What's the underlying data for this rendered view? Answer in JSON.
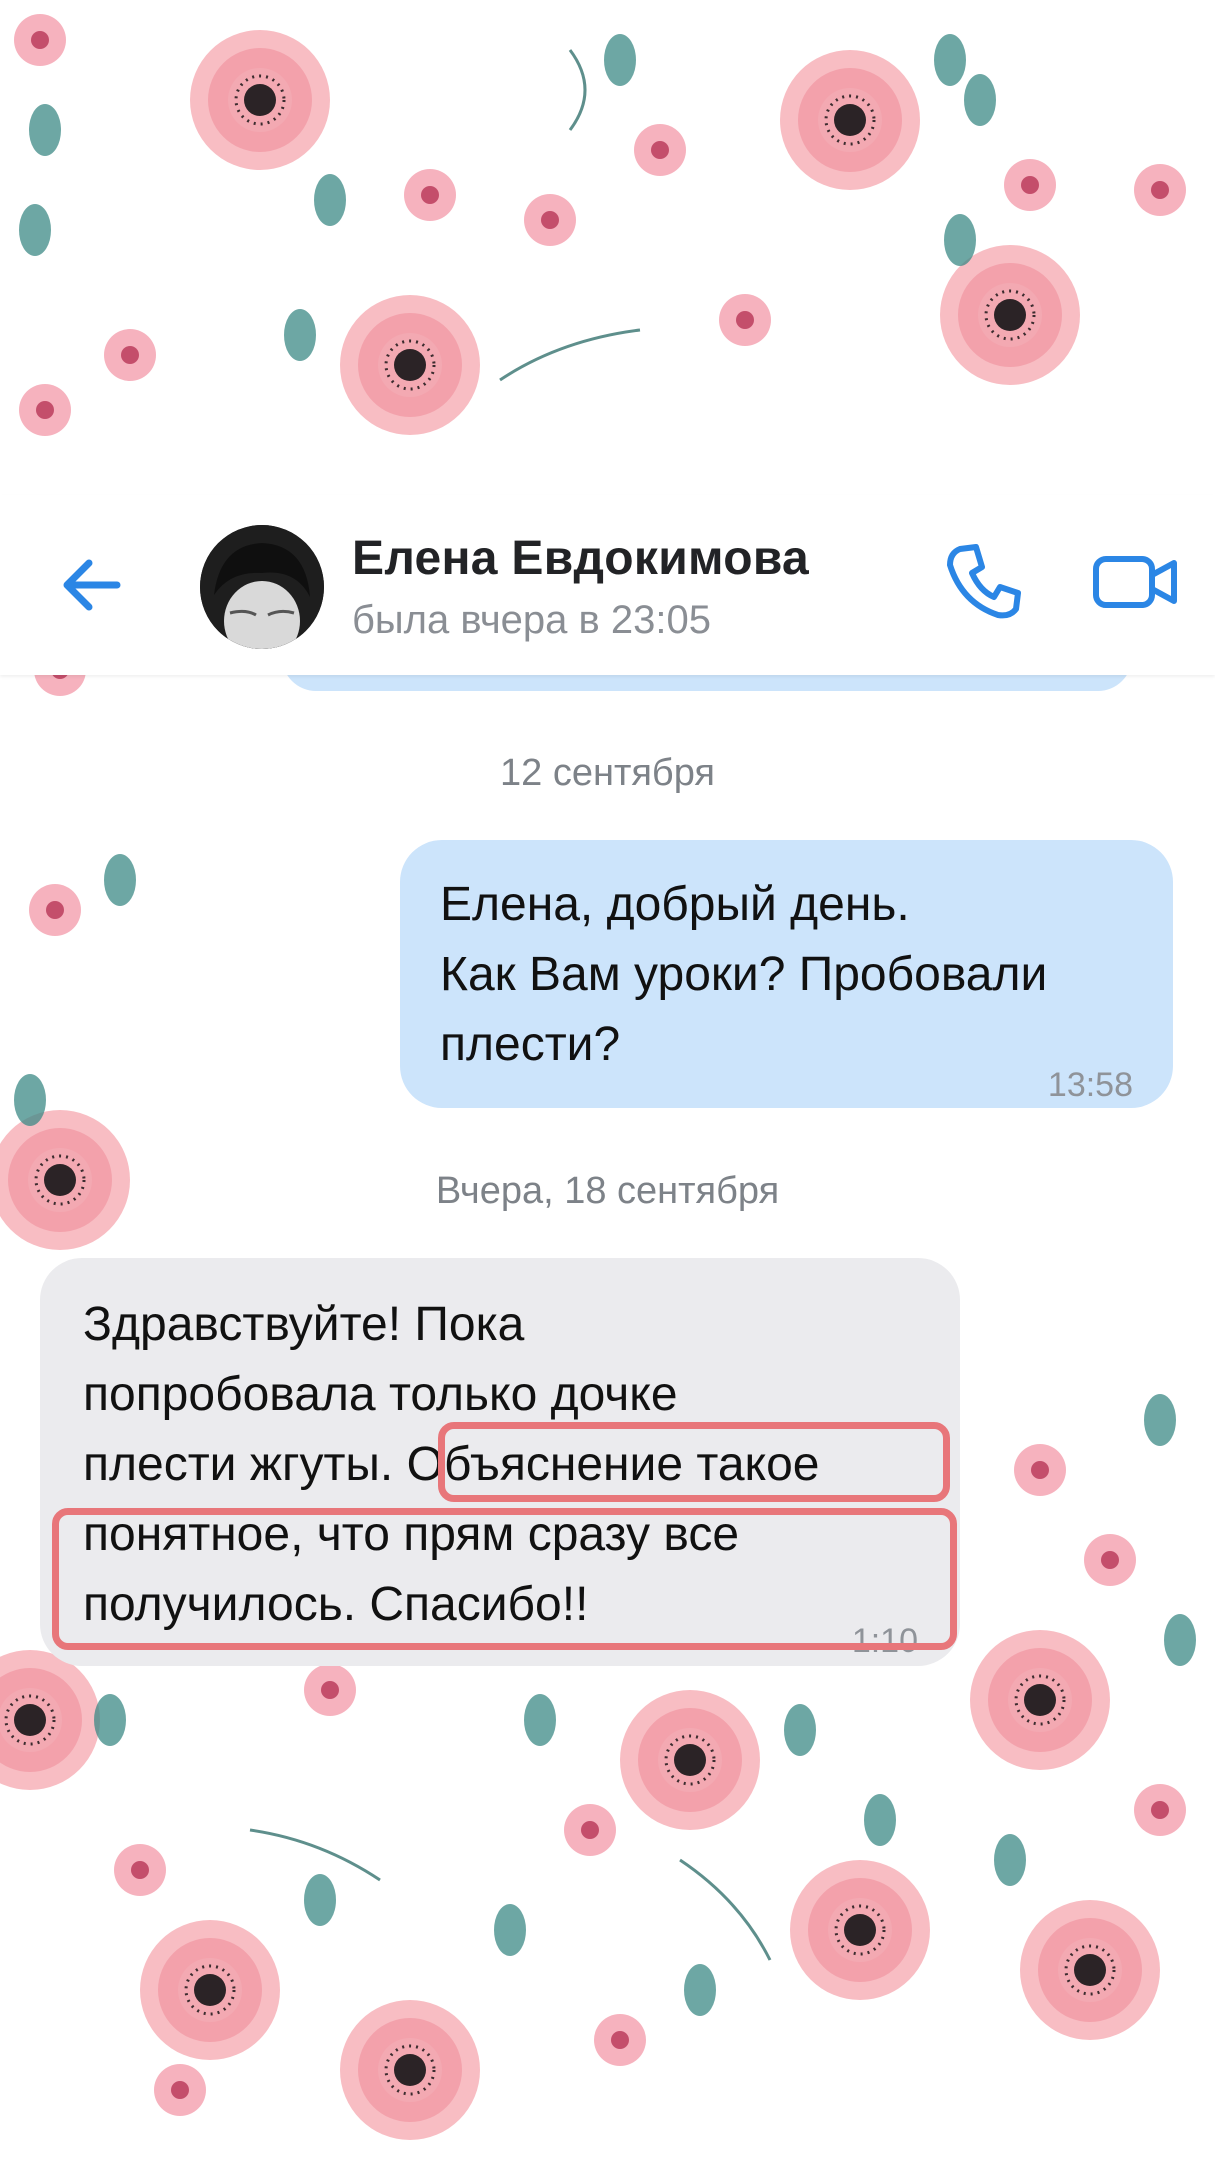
{
  "header": {
    "contact_name": "Елена Евдокимова",
    "last_seen": "была вчера в 23:05",
    "back_icon": "arrow-left-icon",
    "call_icon": "phone-icon",
    "video_icon": "video-camera-icon",
    "accent_color": "#2b86e5"
  },
  "messages": [
    {
      "type": "date_separator",
      "text": "12 сентября"
    },
    {
      "type": "outgoing",
      "lines": [
        "Елена, добрый день.",
        "Как Вам уроки? Пробовали",
        "плести?"
      ],
      "time": "13:58"
    },
    {
      "type": "date_separator",
      "text": "Вчера, 18 сентября"
    },
    {
      "type": "incoming",
      "lines": [
        "Здравствуйте! Пока",
        "попробовала только дочке",
        "плести жгуты. Объяснение такое",
        "понятное, что прям сразу все",
        "получилось. Спасибо!!"
      ],
      "time": "1:10",
      "highlighted_text": "Объяснение такое понятное, что прям сразу все получилось. Спасибо!!"
    }
  ],
  "colors": {
    "outgoing_bubble": "#cce4fb",
    "incoming_bubble": "#ebebee",
    "highlight_border": "#e8767a"
  }
}
